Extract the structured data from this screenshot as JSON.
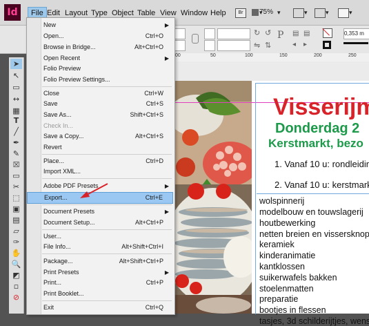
{
  "app": {
    "logo": "Id",
    "zoom": "75%"
  },
  "menubar": {
    "items": [
      "File",
      "Edit",
      "Layout",
      "Type",
      "Object",
      "Table",
      "View",
      "Window",
      "Help"
    ],
    "active": "File"
  },
  "control": {
    "stroke_value": "0,353 m"
  },
  "ruler": {
    "ticks": [
      "00",
      "50",
      "100",
      "150",
      "200",
      "250"
    ]
  },
  "file_menu": {
    "items": [
      {
        "label": "New",
        "shortcut": "",
        "submenu": true
      },
      {
        "label": "Open...",
        "shortcut": "Ctrl+O"
      },
      {
        "label": "Browse in Bridge...",
        "shortcut": "Alt+Ctrl+O"
      },
      {
        "label": "Open Recent",
        "shortcut": "",
        "submenu": true
      },
      {
        "label": "Folio Preview",
        "shortcut": ""
      },
      {
        "label": "Folio Preview Settings...",
        "shortcut": ""
      },
      {
        "label": "Close",
        "shortcut": "Ctrl+W"
      },
      {
        "label": "Save",
        "shortcut": "Ctrl+S"
      },
      {
        "label": "Save As...",
        "shortcut": "Shift+Ctrl+S"
      },
      {
        "label": "Check In...",
        "shortcut": "",
        "disabled": true
      },
      {
        "label": "Save a Copy...",
        "shortcut": "Alt+Ctrl+S"
      },
      {
        "label": "Revert",
        "shortcut": ""
      },
      {
        "label": "Place...",
        "shortcut": "Ctrl+D"
      },
      {
        "label": "Import XML...",
        "shortcut": ""
      },
      {
        "label": "Adobe PDF Presets",
        "shortcut": "",
        "submenu": true
      },
      {
        "label": "Export...",
        "shortcut": "Ctrl+E",
        "highlighted": true
      },
      {
        "label": "Document Presets",
        "shortcut": "",
        "submenu": true
      },
      {
        "label": "Document Setup...",
        "shortcut": "Alt+Ctrl+P"
      },
      {
        "label": "User...",
        "shortcut": ""
      },
      {
        "label": "File Info...",
        "shortcut": "Alt+Shift+Ctrl+I"
      },
      {
        "label": "Package...",
        "shortcut": "Alt+Shift+Ctrl+P"
      },
      {
        "label": "Print Presets",
        "shortcut": "",
        "submenu": true
      },
      {
        "label": "Print...",
        "shortcut": "Ctrl+P"
      },
      {
        "label": "Print Booklet...",
        "shortcut": ""
      },
      {
        "label": "Exit",
        "shortcut": "Ctrl+Q"
      }
    ]
  },
  "document": {
    "title": "Visserijm",
    "date": "Donderdag  2",
    "subtitle": "Kerstmarkt, bezo",
    "numbered": [
      "1. Vanaf 10 u: rondleidin",
      "2. Vanaf 10 u: kerstmark"
    ],
    "list": [
      "wolspinnerij",
      "modelbouw en touwslagerij",
      "houtbewerking",
      "netten breien en vissersknope",
      "keramiek",
      "kinderanimatie",
      "kantklossen",
      "suikerwafels bakken",
      "stoelenmatten",
      "preparatie",
      "bootjes in flessen",
      "tasjes, 3d schilderijtjes, wensk"
    ]
  },
  "colors": {
    "accent_highlight": "#9ac8f2",
    "arrow": "#d8232a",
    "title_red": "#d8232a",
    "green": "#1c9a4a"
  }
}
